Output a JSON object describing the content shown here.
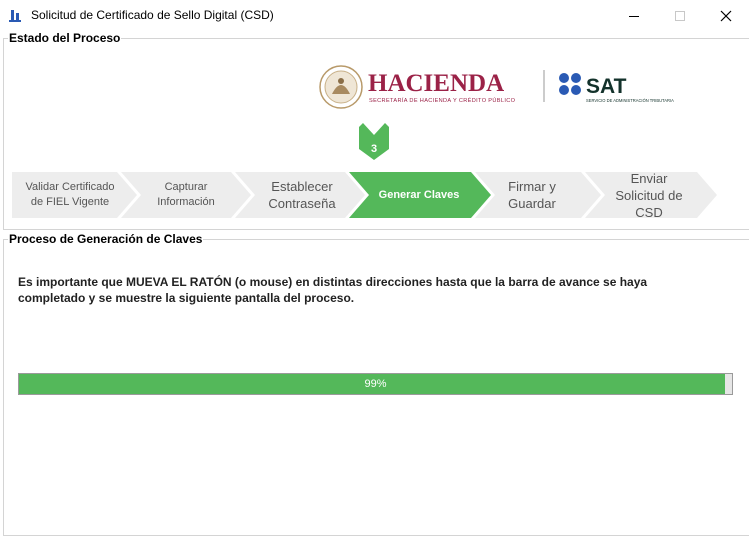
{
  "window": {
    "title": "Solicitud de Certificado de Sello Digital (CSD)"
  },
  "process_section": {
    "label": "Estado del Proceso"
  },
  "logos": {
    "hacienda": "HACIENDA",
    "hacienda_sub": "SECRETARÍA DE HACIENDA Y CRÉDITO PÚBLICO",
    "sat": "SAT",
    "sat_sub": "SERVICIO DE ADMINISTRACIÓN TRIBUTARIA"
  },
  "current_step_marker": "3",
  "steps": [
    {
      "line1": "Validar Certificado",
      "line2": "de FIEL Vigente"
    },
    {
      "line1": "Capturar",
      "line2": "Información"
    },
    {
      "line1": "Establecer",
      "line2": "Contraseña"
    },
    {
      "line1": "Generar Claves",
      "line2": ""
    },
    {
      "line1": "Firmar y",
      "line2": "Guardar"
    },
    {
      "line1": "Enviar",
      "line2": "Solicitud de",
      "line3": "CSD"
    }
  ],
  "keygen_section": {
    "label": "Proceso de Generación de Claves"
  },
  "instruction": "Es importante que MUEVA EL RATÓN (o mouse) en distintas direcciones hasta que la barra de avance se haya completado y se muestre la siguiente pantalla del proceso.",
  "progress": {
    "value": 0.99,
    "label": "99%"
  },
  "colors": {
    "active_step": "#54b85a",
    "inactive_step": "#ededed",
    "hacienda": "#9b2247",
    "sat": "#13322b",
    "sat_dots": "#2a5ab4"
  }
}
